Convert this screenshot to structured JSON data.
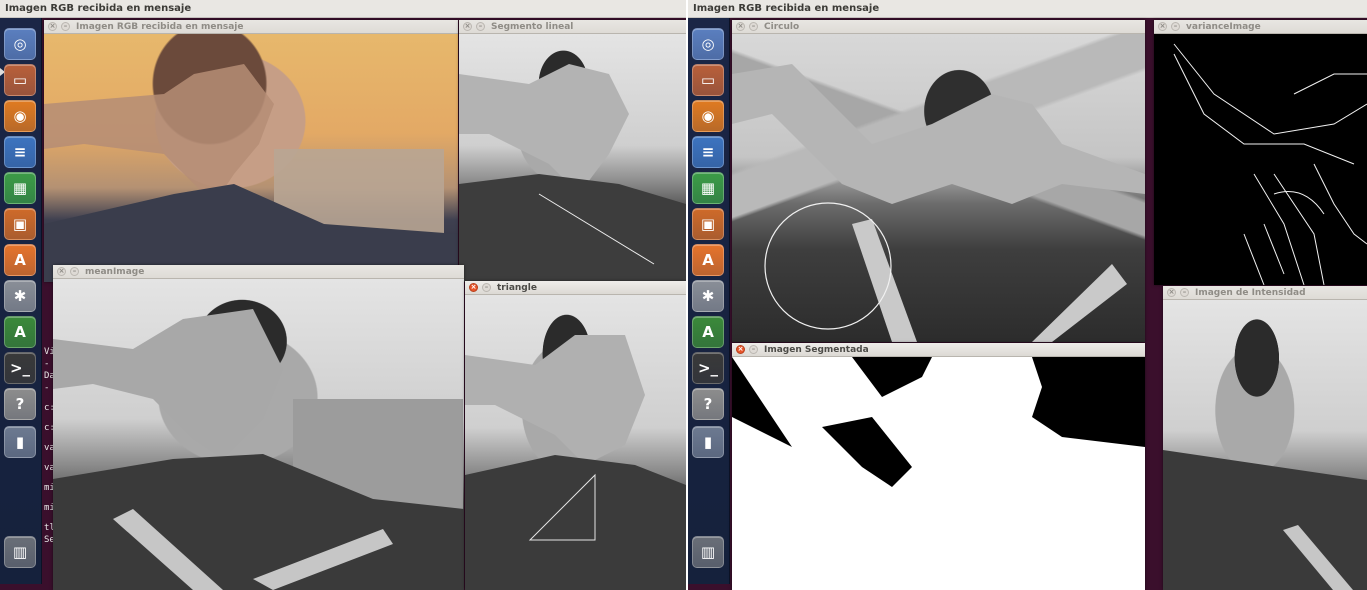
{
  "screen_title": "Imagen RGB recibida en mensaje",
  "launcher": {
    "items": [
      {
        "name": "dash-icon",
        "glyph": "◎",
        "color": "#5b7fbf"
      },
      {
        "name": "files-icon",
        "glyph": "▭",
        "color": "#b9603a"
      },
      {
        "name": "firefox-icon",
        "glyph": "◉",
        "color": "#e07b22"
      },
      {
        "name": "writer-icon",
        "glyph": "≡",
        "color": "#3d74c0"
      },
      {
        "name": "calc-icon",
        "glyph": "▦",
        "color": "#3c9c47"
      },
      {
        "name": "impress-icon",
        "glyph": "▣",
        "color": "#cf6b2a"
      },
      {
        "name": "software-center-icon",
        "glyph": "A",
        "color": "#e6742c"
      },
      {
        "name": "settings-icon",
        "glyph": "✱",
        "color": "#8a8f98"
      },
      {
        "name": "software-updater-icon",
        "glyph": "A",
        "color": "#3b8a3a"
      },
      {
        "name": "terminal-icon",
        "glyph": ">_",
        "color": "#3a3a3a"
      },
      {
        "name": "unknown-app-icon",
        "glyph": "?",
        "color": "#8d8d8d"
      },
      {
        "name": "usb-drive-icon",
        "glyph": "▮",
        "color": "#6d7a91"
      },
      {
        "name": "trash-icon",
        "glyph": "▥",
        "color": "#6a6f78"
      }
    ]
  },
  "left": {
    "windows": {
      "rgb": "Imagen RGB recibida en mensaje",
      "segmento": "Segmento lineal",
      "mean": "meanImage",
      "triangle": "triangle"
    },
    "terminal_lines": [
      "Vi",
      "- ",
      "Da",
      "- ",
      "c:",
      "c:",
      "va",
      "va",
      "mi",
      "mi",
      "tl",
      "Se"
    ]
  },
  "right": {
    "windows": {
      "circulo": "Circulo",
      "variance": "varianceImage",
      "segmentada": "Imagen Segmentada",
      "intensidad": "Imagen de Intensidad"
    }
  }
}
